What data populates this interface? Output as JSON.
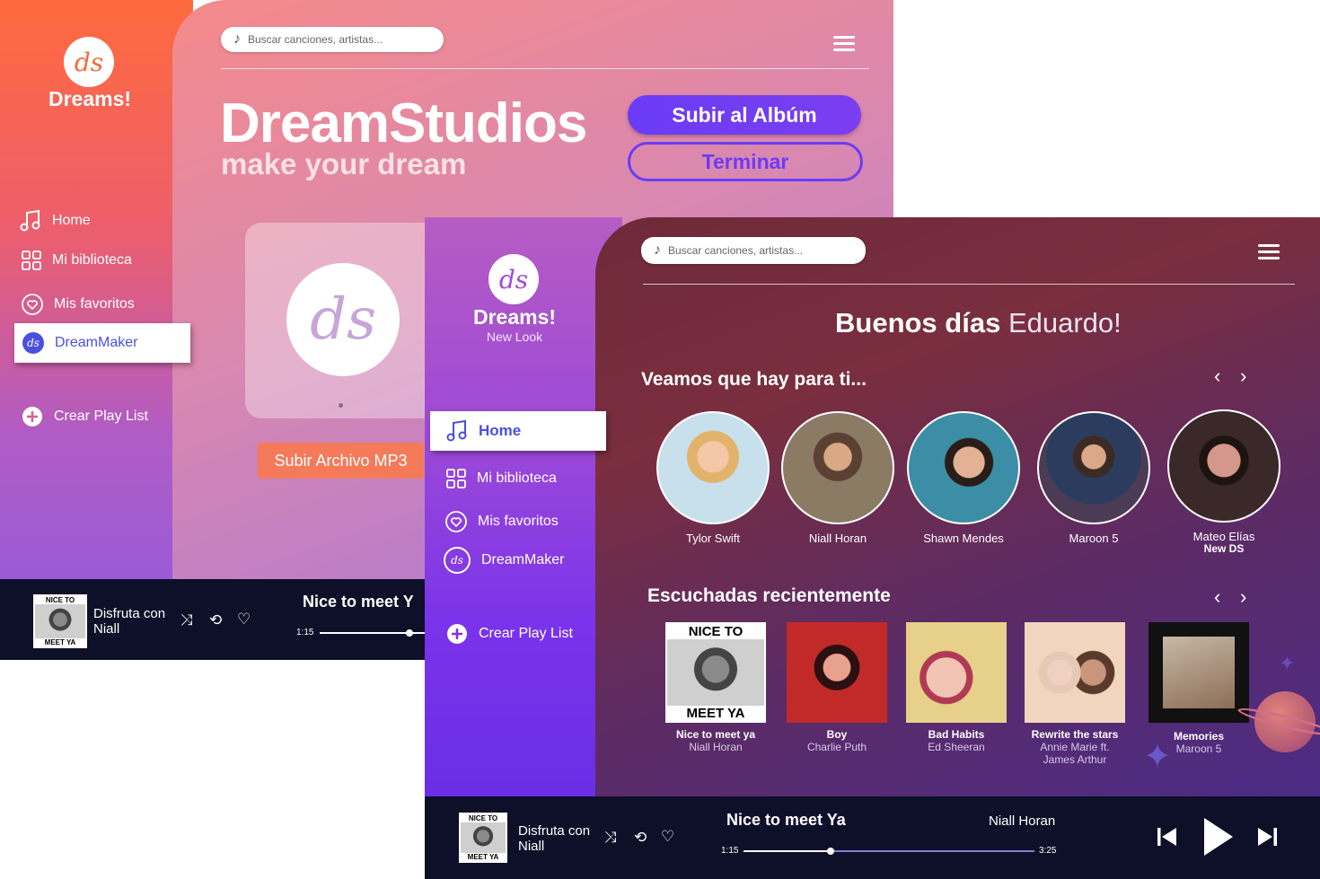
{
  "brand": {
    "logo_letters": "ds",
    "name": "Dreams!",
    "tagline": "New Look"
  },
  "search": {
    "placeholder": "Buscar canciones, artistas..."
  },
  "back": {
    "nav": [
      {
        "label": "Home",
        "icon": "music-note-icon"
      },
      {
        "label": "Mi biblioteca",
        "icon": "grid-icon"
      },
      {
        "label": "Mis favoritos",
        "icon": "heart-icon"
      },
      {
        "label": "DreamMaker",
        "icon": "ds-logo-icon"
      }
    ],
    "create_playlist": "Crear Play List",
    "title": "DreamStudios",
    "subtitle": "make your dream",
    "upload_album": "Subir al Albúm",
    "finish": "Terminar",
    "upload_mp3": "Subir Archivo MP3",
    "player": {
      "cover_top": "NICE TO",
      "cover_bottom": "MEET YA",
      "line1": "Disfruta con",
      "line2": "Niall",
      "song": "Nice to meet Y",
      "elapsed": "1:15",
      "progress": 0.35
    }
  },
  "front": {
    "nav": [
      {
        "label": "Home",
        "icon": "music-note-icon"
      },
      {
        "label": "Mi biblioteca",
        "icon": "grid-icon"
      },
      {
        "label": "Mis favoritos",
        "icon": "heart-icon"
      },
      {
        "label": "DreamMaker",
        "icon": "ds-logo-icon"
      }
    ],
    "create_playlist": "Crear Play List",
    "greeting_bold": "Buenos días",
    "greeting_name": "Eduardo!",
    "section1": "Veamos que hay para ti...",
    "section2": "Escuchadas recientemente",
    "artists": [
      {
        "name": "Tylor Swift",
        "sub": ""
      },
      {
        "name": "Niall Horan",
        "sub": ""
      },
      {
        "name": "Shawn Mendes",
        "sub": ""
      },
      {
        "name": "Maroon 5",
        "sub": ""
      },
      {
        "name": "Mateo Elías",
        "sub": "New DS"
      }
    ],
    "songs": [
      {
        "title": "Nice to meet ya",
        "artist": "Niall Horan"
      },
      {
        "title": "Boy",
        "artist": "Charlie Puth"
      },
      {
        "title": "Bad Habits",
        "artist": "Ed Sheeran"
      },
      {
        "title": "Rewrite the stars",
        "artist": "Annie Marie ft. James Arthur"
      },
      {
        "title": "Memories",
        "artist": "Maroon 5"
      }
    ],
    "player": {
      "cover_top": "NICE TO",
      "cover_bottom": "MEET YA",
      "line1": "Disfruta con",
      "line2": "Niall",
      "song": "Nice to meet Ya",
      "artist": "Niall Horan",
      "elapsed": "1:15",
      "total": "3:25",
      "progress": 0.3
    }
  },
  "colors": {
    "accent_purple": "#6a3cf5",
    "orange": "#ff6a3d",
    "player_bg": "#0e1029"
  }
}
